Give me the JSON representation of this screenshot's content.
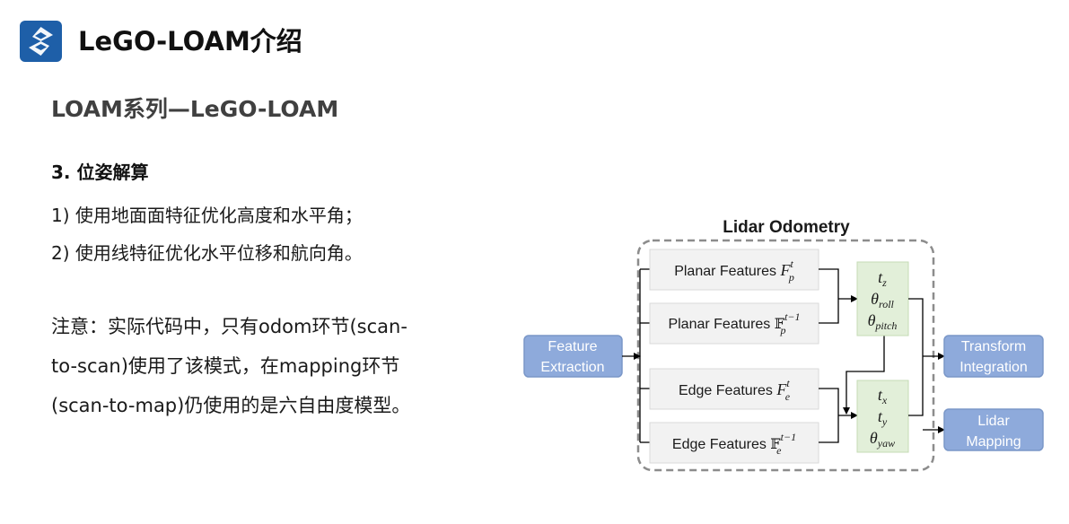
{
  "header": {
    "title": "LeGO-LOAM介绍",
    "logo_icon": "s-logo-icon",
    "brand_color": "#1e5fa8"
  },
  "section": {
    "heading": "LOAM系列—LeGO-LOAM"
  },
  "content": {
    "subheading": "3. 位姿解算",
    "bullets": [
      "1) 使用地面面特征优化高度和水平角；",
      "2) 使用线特征优化水平位移和航向角。"
    ],
    "note_lines": [
      "注意：实际代码中，只有odom环节(scan-",
      "to-scan)使用了该模式，在mapping环节",
      "(scan-to-map)仍使用的是六自由度模型。"
    ]
  },
  "diagram": {
    "title": "Lidar Odometry",
    "colors": {
      "blue_box": "#8eaadb",
      "blue_box_border": "#7a97c8",
      "green_box": "#e2efd9",
      "feature_box": "#f2f2f2",
      "dashed_border": "#8c8c8c"
    },
    "feature_extraction": [
      "Feature",
      "Extraction"
    ],
    "planar_current": {
      "label": "Planar Features ",
      "symbol": "F",
      "sup": "t",
      "sub": "p"
    },
    "planar_previous": {
      "label": "Planar Features ",
      "symbol": "𝔽",
      "sup": "t−1",
      "sub": "p"
    },
    "edge_current": {
      "label": "Edge Features ",
      "symbol": "F",
      "sup": "t",
      "sub": "e"
    },
    "edge_previous": {
      "label": "Edge Features ",
      "symbol": "𝔽",
      "sup": "t−1",
      "sub": "e"
    },
    "planar_params": [
      {
        "base": "t",
        "sub": "z"
      },
      {
        "base": "θ",
        "sub": "roll"
      },
      {
        "base": "θ",
        "sub": "pitch"
      }
    ],
    "edge_params": [
      {
        "base": "t",
        "sub": "x"
      },
      {
        "base": "t",
        "sub": "y"
      },
      {
        "base": "θ",
        "sub": "yaw"
      }
    ],
    "transform_integration": [
      "Transform",
      "Integration"
    ],
    "lidar_mapping": [
      "Lidar",
      "Mapping"
    ]
  }
}
